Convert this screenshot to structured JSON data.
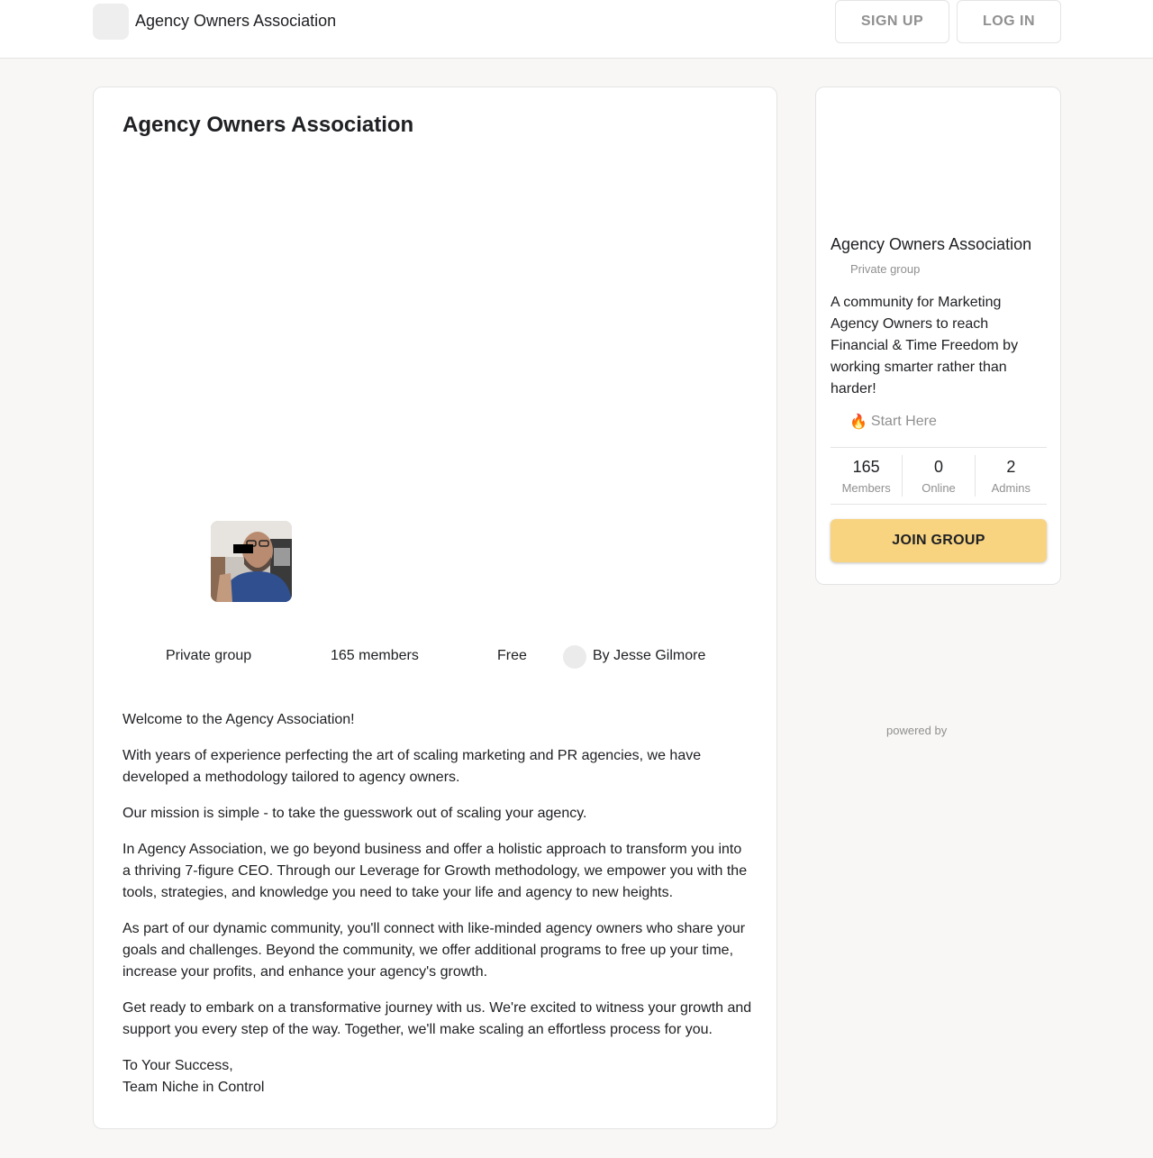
{
  "header": {
    "brand": "Agency Owners Association",
    "signup_label": "SIGN UP",
    "login_label": "LOG IN"
  },
  "main": {
    "title": "Agency Owners Association",
    "meta": {
      "privacy": "Private group",
      "members": "165 members",
      "price": "Free",
      "owner": "By Jesse Gilmore"
    },
    "description": [
      "Welcome to the Agency Association!",
      "With years of experience perfecting the art of scaling marketing and PR agencies, we have developed a methodology tailored to agency owners.",
      "Our mission is simple - to take the guesswork out of scaling your agency.",
      "In Agency Association, we go beyond business and offer a holistic approach to transform you into a thriving 7-figure CEO. Through our Leverage for Growth methodology, we empower you with the tools, strategies, and knowledge you need to take your life and agency to new heights.",
      "As part of our dynamic community, you'll connect with like-minded agency owners who share your goals and challenges. Beyond the community, we offer additional programs to free up your time, increase your profits, and enhance your agency's growth.",
      "Get ready to embark on a transformative journey with us. We're excited to witness your growth and support you every step of the way. Together, we'll make scaling an effortless process for you.",
      "To Your Success,",
      "Team Niche in Control"
    ]
  },
  "sidebar": {
    "name": "Agency Owners Association",
    "privacy": "Private group",
    "description": "A community for Marketing Agency Owners to reach Financial & Time Freedom by working smarter rather than harder!",
    "link_icon": "🔥",
    "link_label": "Start Here",
    "stats": [
      {
        "value": "165",
        "label": "Members"
      },
      {
        "value": "0",
        "label": "Online"
      },
      {
        "value": "2",
        "label": "Admins"
      }
    ],
    "join_label": "JOIN GROUP"
  },
  "footer": {
    "powered_by": "powered by"
  },
  "colors": {
    "join_button": "#f8d481",
    "page_background": "#f8f7f5",
    "muted_text": "#909090"
  }
}
